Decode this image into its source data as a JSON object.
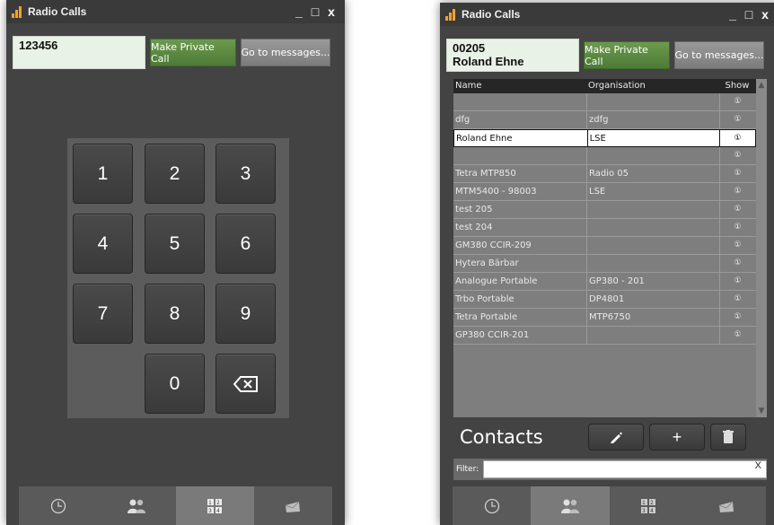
{
  "dialer_window": {
    "title": "Radio Calls",
    "controls": {
      "minimize": "_",
      "maximize": "□",
      "close": "x"
    },
    "number_value": "123456",
    "make_private_call_label": "Make Private Call",
    "go_to_messages_label": "Go to messages...",
    "keys": [
      "1",
      "2",
      "3",
      "4",
      "5",
      "6",
      "7",
      "8",
      "9",
      "0"
    ],
    "active_tab": "keypad"
  },
  "contacts_window": {
    "title": "Radio Calls",
    "controls": {
      "minimize": "_",
      "maximize": "□",
      "close": "x"
    },
    "selected_id": "00205",
    "selected_name": "Roland Ehne",
    "make_private_call_label": "Make Private Call",
    "go_to_messages_label": "Go to messages...",
    "columns": {
      "name": "Name",
      "organisation": "Organisation",
      "show": "Show"
    },
    "rows": [
      {
        "name": "",
        "organisation": "",
        "show": "①"
      },
      {
        "name": "dfg",
        "organisation": "zdfg",
        "show": "①"
      },
      {
        "name": "Roland Ehne",
        "organisation": "LSE",
        "show": "①",
        "selected": true
      },
      {
        "name": "",
        "organisation": "",
        "show": "①"
      },
      {
        "name": "Tetra MTP850",
        "organisation": "Radio 05",
        "show": "①"
      },
      {
        "name": "MTM5400 - 98003",
        "organisation": "LSE",
        "show": "①"
      },
      {
        "name": "test 205",
        "organisation": "",
        "show": "①"
      },
      {
        "name": "test 204",
        "organisation": "",
        "show": "①"
      },
      {
        "name": "GM380 CCIR-209",
        "organisation": "",
        "show": "①"
      },
      {
        "name": "Hytera Bärbar",
        "organisation": "",
        "show": "①"
      },
      {
        "name": "Analogue Portable",
        "organisation": "GP380 - 201",
        "show": "①"
      },
      {
        "name": "Trbo Portable",
        "organisation": "DP4801",
        "show": "①"
      },
      {
        "name": "Tetra Portable",
        "organisation": "MTP6750",
        "show": "①"
      },
      {
        "name": "GP380 CCIR-201",
        "organisation": "",
        "show": "①"
      }
    ],
    "contacts_label": "Contacts",
    "add_label": "+",
    "filter_label": "Filter:",
    "filter_value": "",
    "filter_clear": "X",
    "active_tab": "contacts"
  },
  "colors": {
    "window_bg": "#434343",
    "accent_green": "#5a8a40",
    "number_field_bg": "#e9f2e6",
    "title_icon": "#f0a030"
  },
  "tab_icons": [
    "clock-icon",
    "people-icon",
    "keypad-icon",
    "messages-icon"
  ]
}
